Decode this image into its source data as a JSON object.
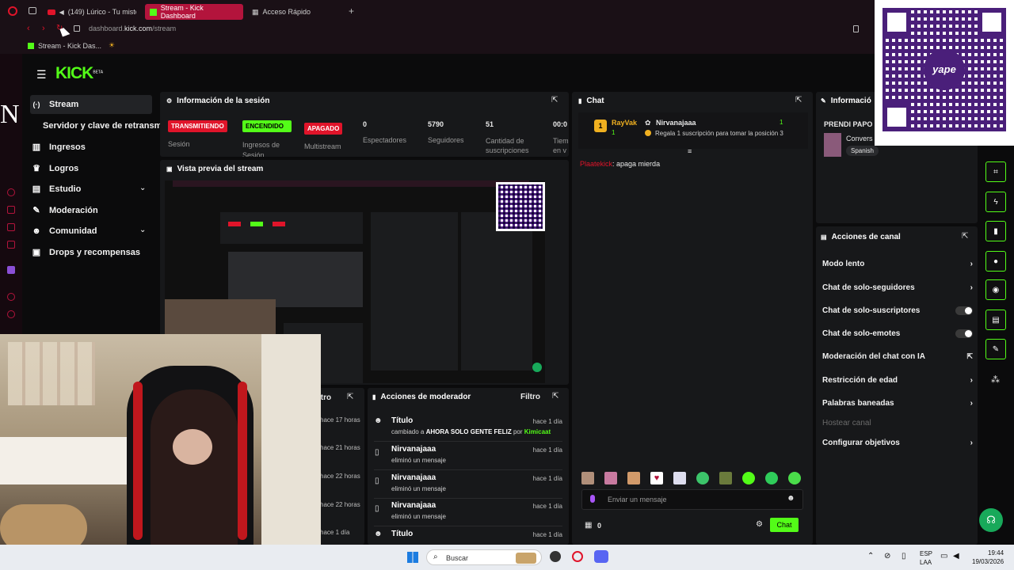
{
  "browser": {
    "tabs": [
      {
        "label": "(149) Lúrico - Tu miste"
      },
      {
        "label": "Stream - Kick Dashboard"
      },
      {
        "label": "Acceso Rápido"
      }
    ],
    "url_prefix": "dashboard.",
    "url_domain": "kick.com",
    "url_path": "/stream",
    "bookmark": "Stream - Kick Das..."
  },
  "sidebar": {
    "logo": "KICK",
    "logo_badge": "BETA",
    "items": [
      {
        "label": "Stream"
      },
      {
        "label": "Servidor y clave de retransm"
      },
      {
        "label": "Ingresos"
      },
      {
        "label": "Logros"
      },
      {
        "label": "Estudio"
      },
      {
        "label": "Moderación"
      },
      {
        "label": "Comunidad"
      },
      {
        "label": "Drops y recompensas"
      }
    ]
  },
  "session": {
    "title": "Información de la sesión",
    "stats": [
      {
        "badge": "TRANSMITIENDO",
        "label": "Sesión"
      },
      {
        "badge": "ENCENDIDO",
        "label": "Ingresos de Sesión"
      },
      {
        "badge": "APAGADO",
        "label": "Multistream"
      },
      {
        "value": "0",
        "label": "Espectadores"
      },
      {
        "value": "5790",
        "label": "Seguidores"
      },
      {
        "value": "51",
        "label": "Cantidad de suscripciones"
      },
      {
        "value": "00:0",
        "label": "Tiem en v"
      }
    ]
  },
  "preview": {
    "title": "Vista previa del stream"
  },
  "chat": {
    "title": "Chat",
    "pinned_rank": "1",
    "pinned_user": "RayVak",
    "pinned_user_count": "1",
    "gift_user": "Nirvanajaaa",
    "gift_count": "1",
    "gift_text": "Regala 1 suscripción para tomar la posición 3",
    "messages": [
      {
        "user": "Plaatekick",
        "text": ": apaga mierda"
      }
    ],
    "input_placeholder": "Enviar un mensaje",
    "points": "0",
    "send_label": "Chat"
  },
  "info_panel": {
    "title": "Informació",
    "stream_title": "PRENDI PAPO",
    "category": "Convers",
    "language": "Spanish"
  },
  "channel_actions": {
    "title": "Acciones de canal",
    "items": [
      {
        "label": "Modo lento",
        "control": "chevron"
      },
      {
        "label": "Chat de solo-seguidores",
        "control": "chevron"
      },
      {
        "label": "Chat de solo-suscriptores",
        "control": "toggle"
      },
      {
        "label": "Chat de solo-emotes",
        "control": "toggle"
      },
      {
        "label": "Moderación del chat con IA",
        "control": "external"
      },
      {
        "label": "Restricción de edad",
        "control": "chevron"
      },
      {
        "label": "Palabras baneadas",
        "control": "chevron"
      },
      {
        "label": "Hostear canal",
        "control": "none"
      },
      {
        "label": "Configurar objetivos",
        "control": "chevron"
      }
    ]
  },
  "mod_actions": {
    "title": "Acciones de moderador",
    "filter_label": "Filtro",
    "rows": [
      {
        "title": "Título",
        "action": "cambiado a",
        "value": "AHORA SOLO GENTE FELIZ",
        "by": "por",
        "author": "Kimicaat",
        "time": "hace 1 día"
      },
      {
        "title": "Nirvanajaaa",
        "action": "eliminó un mensaje",
        "time": "hace 1 día"
      },
      {
        "title": "Nirvanajaaa",
        "action": "eliminó un mensaje",
        "time": "hace 1 día"
      },
      {
        "title": "Nirvanajaaa",
        "action": "eliminó un mensaje",
        "time": "hace 1 día"
      },
      {
        "title": "Título",
        "action": "",
        "time": "hace 1 día"
      }
    ]
  },
  "left_partial": {
    "filter_label": "ltro",
    "times": [
      "hace 17 horas",
      "hace 21 horas",
      "hace 22 horas",
      "hace 22 horas",
      "hace 1 día"
    ]
  },
  "overlay_letter": "N",
  "qr_label": "yape",
  "taskbar": {
    "search_placeholder": "Buscar",
    "lang_top": "ESP",
    "lang_bottom": "LAA",
    "time": "19:44",
    "date": "19/03/2026"
  },
  "colors": {
    "accent": "#53fc18",
    "live": "#e0142a",
    "opera": "#b3143c",
    "qr": "#4a1f7a"
  }
}
